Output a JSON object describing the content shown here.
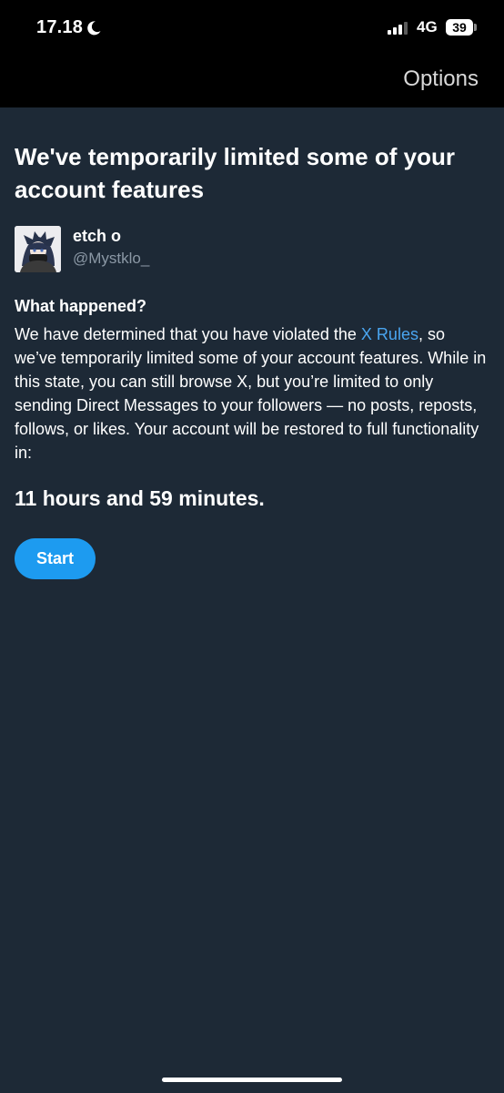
{
  "status_bar": {
    "time": "17.18",
    "network": "4G",
    "battery": "39",
    "icons": [
      "moon-icon",
      "signal-icon"
    ]
  },
  "header": {
    "options_label": "Options"
  },
  "notice": {
    "title": "We've temporarily limited some of your account features",
    "user": {
      "display_name": "etch o",
      "handle": "@Mystklo_"
    },
    "section_heading": "What happened?",
    "body_before_link": "We have determined that you have violated the ",
    "link_text": "X Rules",
    "body_after_link": ", so we’ve temporarily limited some of your account features. While in this state, you can still browse X, but you’re limited to only sending Direct Messages to your followers — no posts, reposts, follows, or likes. Your account will be restored to full functionality in:",
    "countdown": "11 hours and 59 minutes.",
    "start_label": "Start"
  },
  "colors": {
    "background": "#1d2936",
    "top_bar": "#000000",
    "accent": "#1d9bf0",
    "link": "#4aa5f0",
    "muted_text": "#8b98a5"
  }
}
